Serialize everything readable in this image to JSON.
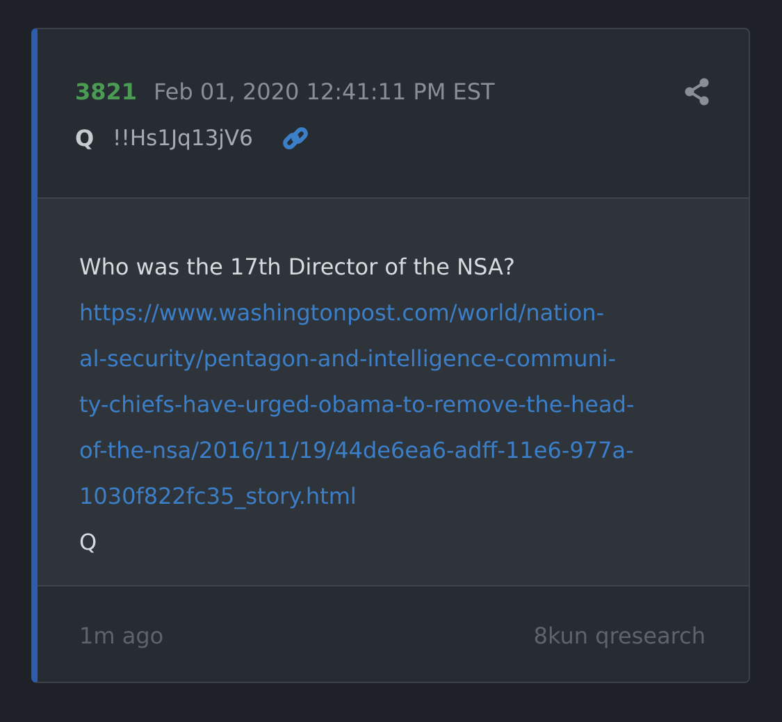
{
  "post": {
    "number": "3821",
    "timestamp": "Feb 01, 2020 12:41:11 PM EST",
    "author": "Q",
    "tripcode": "!!Hs1Jq13jV6",
    "question": "Who was the 17th Director of the NSA?",
    "url_lines": [
      "https://www.washingtonpost.com/world/nation-",
      "al-security/pentagon-and-intelligence-communi-",
      "ty-chiefs-have-urged-obama-to-remove-the-head-",
      "of-the-nsa/2016/11/19/44de6ea6-adff-11e6-977a-",
      "1030f822fc35_story.html"
    ],
    "signature": "Q"
  },
  "footer": {
    "age": "1m ago",
    "source": "8kun qresearch"
  },
  "icons": {
    "share": "share-icon",
    "link": "link-icon"
  },
  "colors": {
    "post_number": "#4a9c52",
    "accent_bar": "#2b5fad",
    "link": "#3c7fc9"
  }
}
